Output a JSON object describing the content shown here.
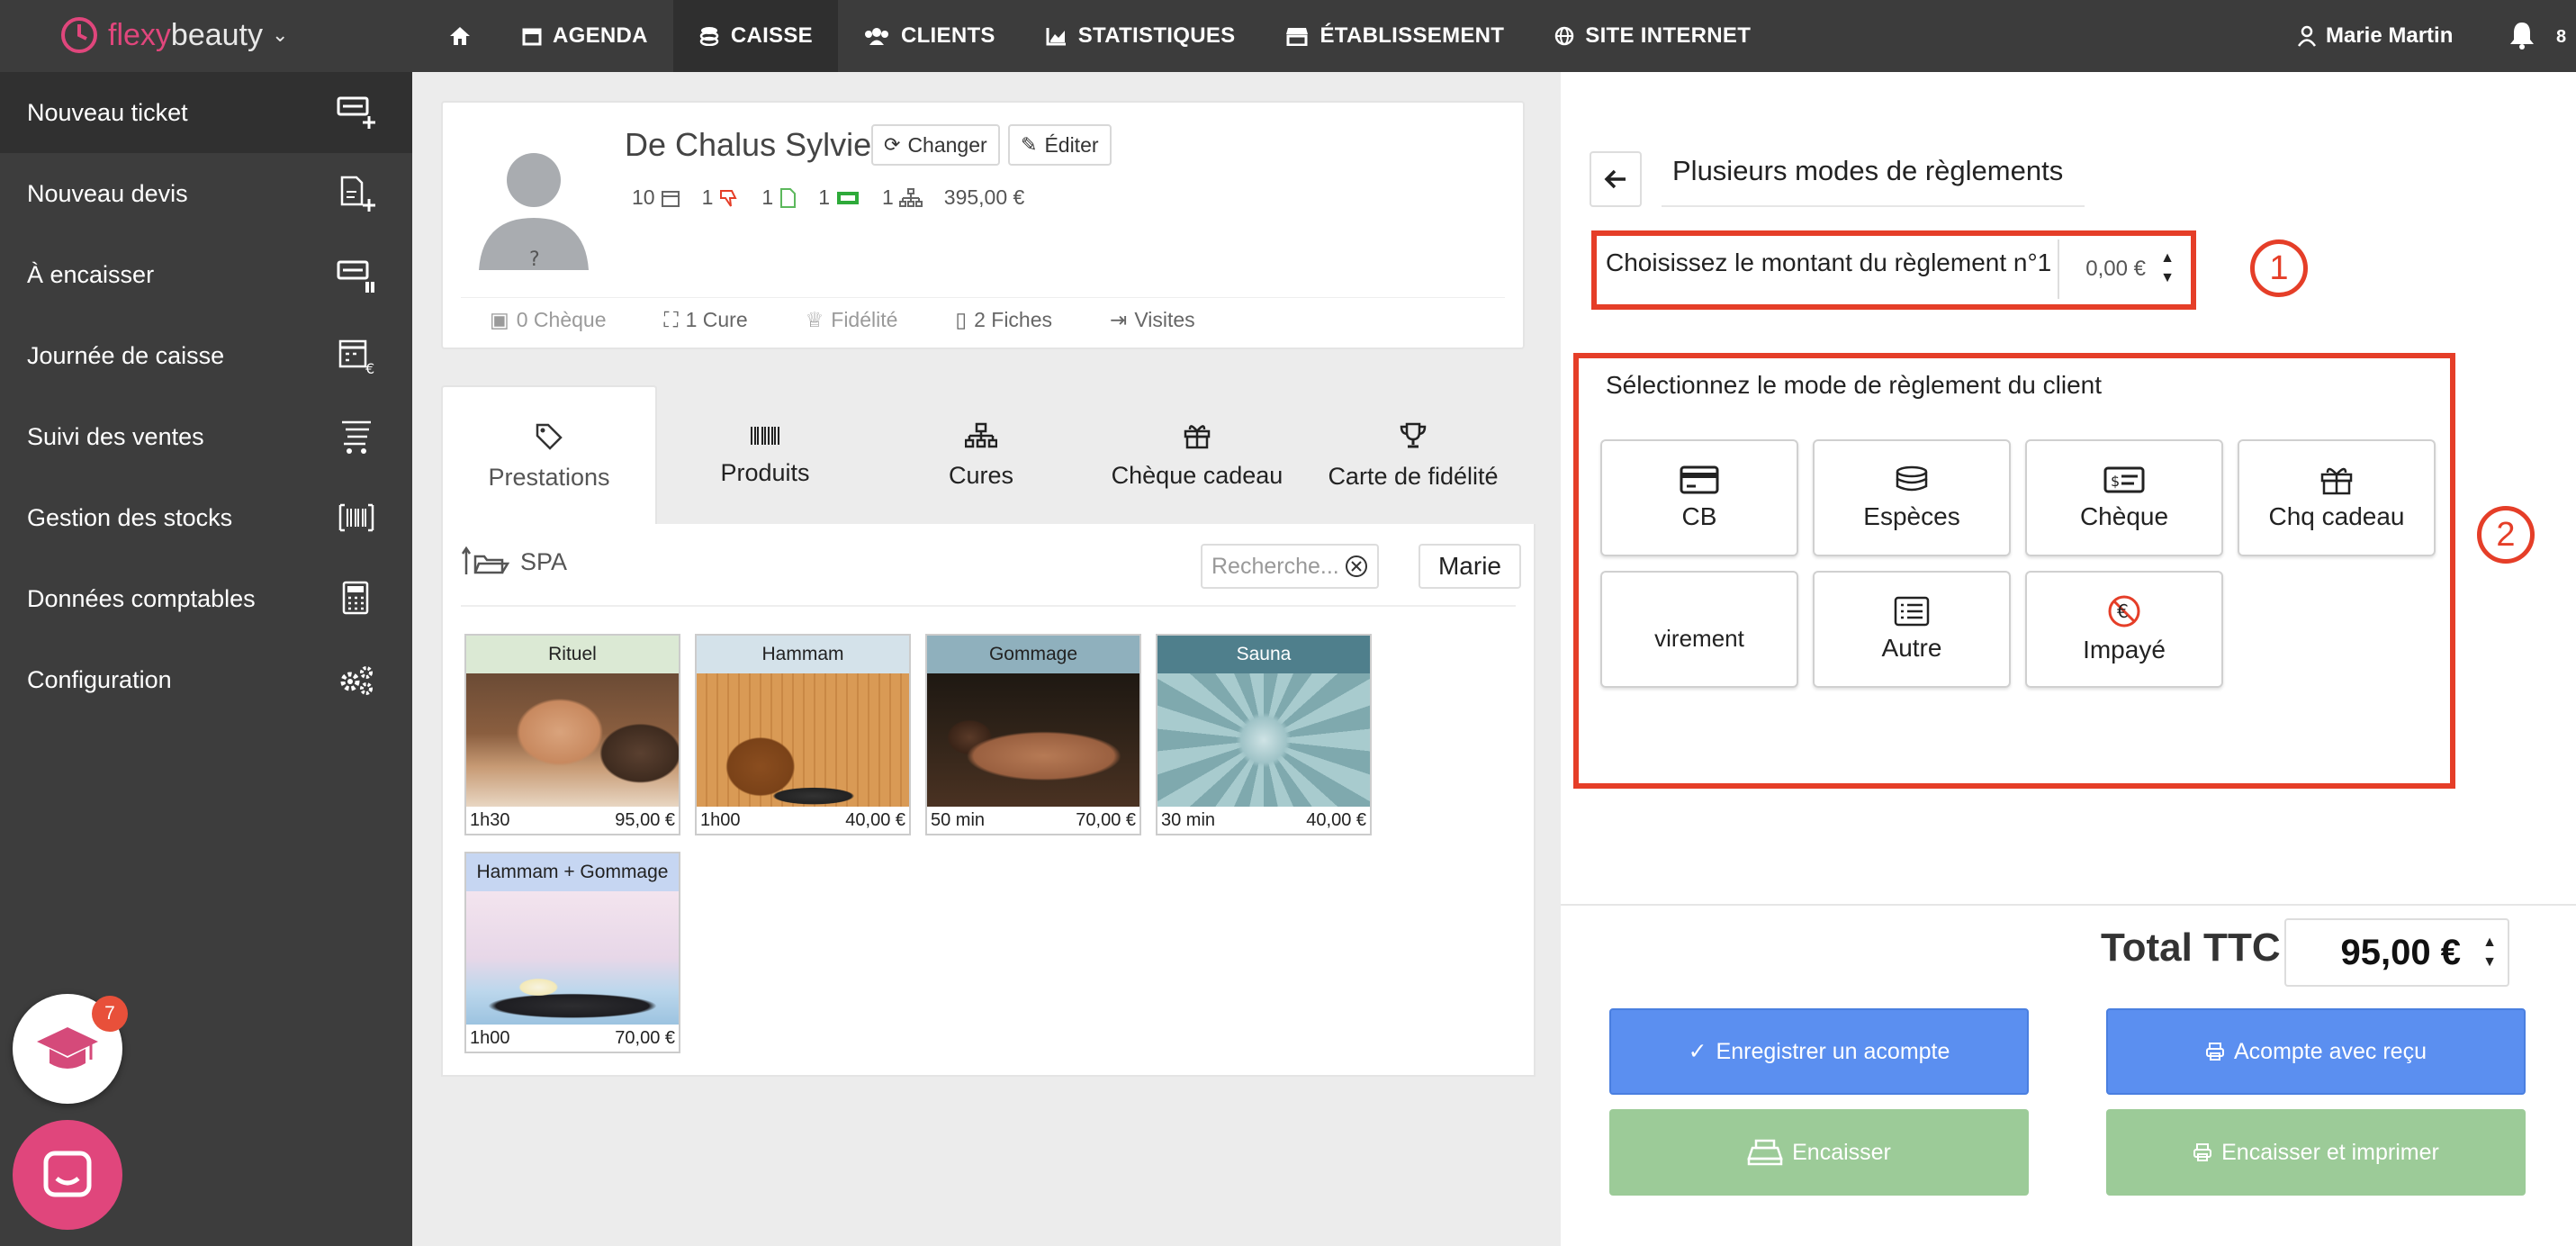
{
  "brand": {
    "part1": "flexy",
    "part2": "beauty"
  },
  "nav": {
    "items": [
      {
        "label": "",
        "icon": "home-icon"
      },
      {
        "label": "AGENDA",
        "icon": "calendar-icon"
      },
      {
        "label": "CAISSE",
        "icon": "coins-icon",
        "active": true
      },
      {
        "label": "CLIENTS",
        "icon": "users-icon"
      },
      {
        "label": "STATISTIQUES",
        "icon": "chart-icon"
      },
      {
        "label": "ÉTABLISSEMENT",
        "icon": "store-icon"
      },
      {
        "label": "SITE INTERNET",
        "icon": "globe-icon"
      }
    ],
    "user": "Marie Martin",
    "notifications": "8"
  },
  "sidebar": {
    "items": [
      {
        "label": "Nouveau ticket"
      },
      {
        "label": "Nouveau devis"
      },
      {
        "label": "À encaisser"
      },
      {
        "label": "Journée de caisse"
      },
      {
        "label": "Suivi des ventes"
      },
      {
        "label": "Gestion des stocks"
      },
      {
        "label": "Données comptables"
      },
      {
        "label": "Configuration"
      }
    ]
  },
  "client": {
    "name": "De Chalus Sylvie",
    "avatar_mark": "?",
    "change_label": "Changer",
    "edit_label": "Éditer",
    "stats": {
      "visits": "10",
      "dislikes": "1",
      "files": "1",
      "cards": "1",
      "cures": "1",
      "amount": "395,00 €"
    },
    "links": [
      "0 Chèque",
      "1 Cure",
      "Fidélité",
      "2 Fiches",
      "Visites"
    ]
  },
  "tabs": [
    "Prestations",
    "Produits",
    "Cures",
    "Chèque cadeau",
    "Carte de fidélité"
  ],
  "catalog": {
    "folder": "SPA",
    "search_placeholder": "Recherche...",
    "staff": "Marie",
    "services": [
      {
        "name": "Rituel",
        "duration": "1h30",
        "price": "95,00 €"
      },
      {
        "name": "Hammam",
        "duration": "1h00",
        "price": "40,00 €"
      },
      {
        "name": "Gommage",
        "duration": "50 min",
        "price": "70,00 €"
      },
      {
        "name": "Sauna",
        "duration": "30 min",
        "price": "40,00 €"
      },
      {
        "name": "Hammam + Gommage",
        "duration": "1h00",
        "price": "70,00 €"
      }
    ]
  },
  "payment": {
    "title": "Plusieurs modes de règlements",
    "amount_label": "Choisissez le montant du règlement n°1",
    "amount_value": "0,00 €",
    "step1": "1",
    "step2": "2",
    "select_label": "Sélectionnez le mode de règlement du client",
    "methods": [
      {
        "label": "CB",
        "icon": "credit-card-icon"
      },
      {
        "label": "Espèces",
        "icon": "coins-icon"
      },
      {
        "label": "Chèque",
        "icon": "cheque-icon"
      },
      {
        "label": "Chq cadeau",
        "icon": "gift-icon"
      },
      {
        "label": "virement",
        "icon": ""
      },
      {
        "label": "Autre",
        "icon": "list-icon"
      },
      {
        "label": "Impayé",
        "icon": "no-euro-icon"
      }
    ],
    "total_label": "Total TTC",
    "total_value": "95,00 €",
    "actions": {
      "deposit": "Enregistrer un acompte",
      "deposit_receipt": "Acompte avec reçu",
      "cash_in": "Encaisser",
      "cash_in_print": "Encaisser et imprimer"
    }
  },
  "widgets": {
    "academy_badge": "7"
  },
  "colors": {
    "accent": "#e0467c",
    "sidebar": "#3d3d3d",
    "highlight": "#e53e28",
    "primary": "#5b8ff0",
    "success": "#9ccb98"
  }
}
